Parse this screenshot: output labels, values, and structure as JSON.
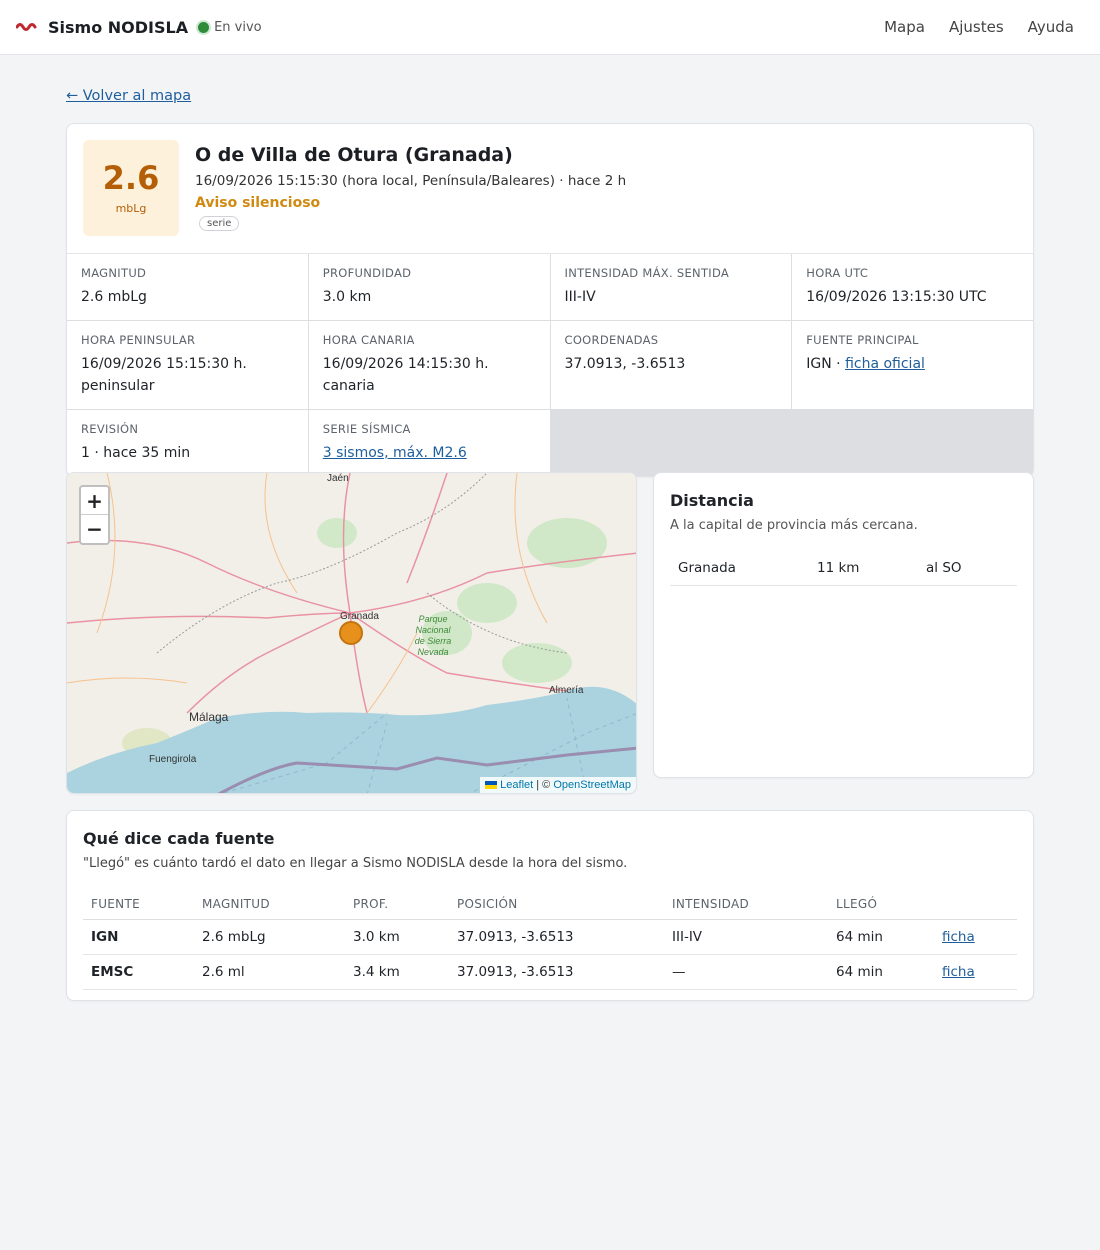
{
  "header": {
    "brand": "Sismo NODISLA",
    "live": "En vivo",
    "nav": [
      "Mapa",
      "Ajustes",
      "Ayuda"
    ]
  },
  "back": "← Volver al mapa",
  "event": {
    "magnitude": "2.6",
    "unit": "mbLg",
    "title": "O de Villa de Otura (Granada)",
    "when": "16/09/2026 15:15:30 (hora local, Península/Baleares) · hace 2 h",
    "alert": "Aviso silencioso",
    "tag": "serie"
  },
  "fields": {
    "magnitud": {
      "label": "MAGNITUD",
      "value": "2.6 mbLg"
    },
    "profundidad": {
      "label": "PROFUNDIDAD",
      "value": "3.0 km"
    },
    "intensidad": {
      "label": "INTENSIDAD MÁX. SENTIDA",
      "value": "III-IV"
    },
    "hora_utc": {
      "label": "HORA UTC",
      "value": "16/09/2026 13:15:30 UTC"
    },
    "hora_peninsular": {
      "label": "HORA PENINSULAR",
      "value": "16/09/2026 15:15:30 h. peninsular"
    },
    "hora_canaria": {
      "label": "HORA CANARIA",
      "value": "16/09/2026 14:15:30 h. canaria"
    },
    "coordenadas": {
      "label": "COORDENADAS",
      "value": "37.0913, -3.6513"
    },
    "fuente": {
      "label": "FUENTE PRINCIPAL",
      "value": "IGN ·",
      "link": "ficha oficial"
    },
    "revision": {
      "label": "REVISIÓN",
      "value": "1 · hace 35 min"
    },
    "serie": {
      "label": "SERIE SÍSMICA",
      "link": "3 sismos, máx. M2.6"
    }
  },
  "map": {
    "zoom_in": "+",
    "zoom_out": "−",
    "places": {
      "jaen": "Jaén",
      "granada": "Granada",
      "malaga": "Málaga",
      "almeria": "Almería",
      "fuengirola": "Fuengirola",
      "parque": [
        "Parque",
        "Nacional",
        "de Sierra",
        "Nevada"
      ]
    },
    "attribution": {
      "leaflet": "Leaflet",
      "sep": "| ©",
      "osm": "OpenStreetMap"
    },
    "colors": {
      "land": "#f2efe9",
      "sea": "#aad3df",
      "marker": "#e8901c"
    }
  },
  "distance": {
    "title": "Distancia",
    "subtitle": "A la capital de provincia más cercana.",
    "city": "Granada",
    "km": "11 km",
    "dir": "al SO"
  },
  "sources": {
    "title": "Qué dice cada fuente",
    "subtitle": "\"Llegó\" es cuánto tardó el dato en llegar a Sismo NODISLA desde la hora del sismo.",
    "headers": [
      "FUENTE",
      "MAGNITUD",
      "PROF.",
      "POSICIÓN",
      "INTENSIDAD",
      "LLEGÓ"
    ],
    "rows": [
      [
        "IGN",
        "2.6 mbLg",
        "3.0 km",
        "37.0913, -3.6513",
        "III-IV",
        "64 min",
        "ficha"
      ],
      [
        "EMSC",
        "2.6 ml",
        "3.4 km",
        "37.0913, -3.6513",
        "—",
        "64 min",
        "ficha"
      ]
    ]
  }
}
